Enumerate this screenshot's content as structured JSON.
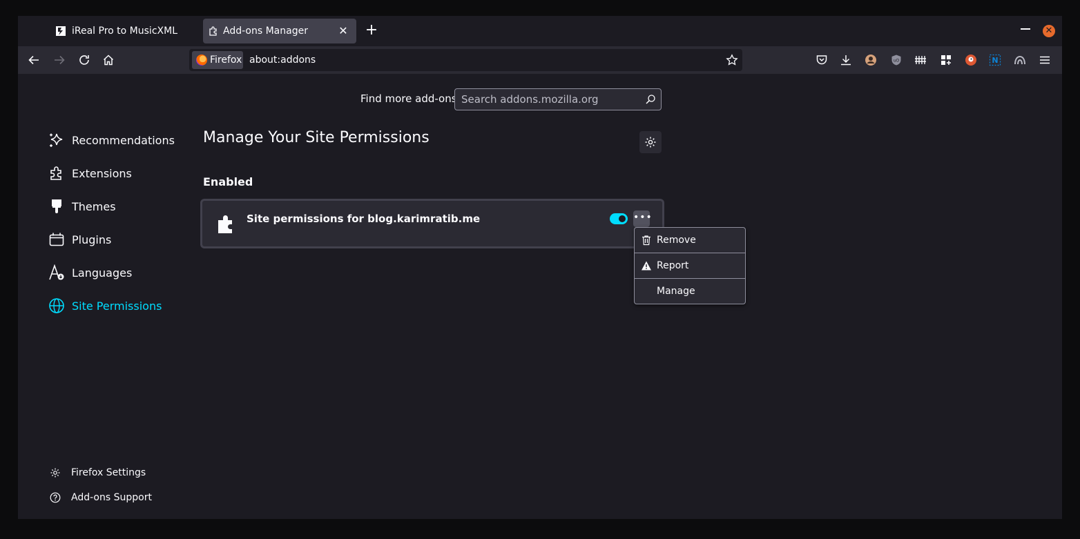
{
  "tabs": [
    {
      "title": "iReal Pro to MusicXML",
      "favicon": "ireal-favicon",
      "active": false
    },
    {
      "title": "Add-ons Manager",
      "favicon": "puzzle-icon",
      "active": true
    }
  ],
  "urlbar": {
    "identity_label": "Firefox",
    "url": "about:addons"
  },
  "search": {
    "label": "Find more add-ons",
    "placeholder": "Search addons.mozilla.org"
  },
  "sidebar": {
    "items": [
      {
        "label": "Recommendations",
        "icon": "sparkle-icon"
      },
      {
        "label": "Extensions",
        "icon": "puzzle-icon"
      },
      {
        "label": "Themes",
        "icon": "brush-icon"
      },
      {
        "label": "Plugins",
        "icon": "plugin-icon"
      },
      {
        "label": "Languages",
        "icon": "language-icon"
      },
      {
        "label": "Site Permissions",
        "icon": "globe-icon",
        "selected": true
      }
    ],
    "footer": [
      {
        "label": "Firefox Settings",
        "icon": "gear-icon"
      },
      {
        "label": "Add-ons Support",
        "icon": "help-icon"
      }
    ]
  },
  "main": {
    "title": "Manage Your Site Permissions",
    "section": "Enabled",
    "addon": {
      "name": "Site permissions for blog.karimratib.me",
      "enabled": true
    },
    "menu": [
      {
        "label": "Remove",
        "icon": "trash-icon"
      },
      {
        "label": "Report",
        "icon": "warning-icon"
      },
      {
        "label": "Manage",
        "icon": ""
      }
    ]
  },
  "colors": {
    "accent": "#00ddff",
    "background": "#1c1b22",
    "toolbar": "#2b2a33"
  }
}
